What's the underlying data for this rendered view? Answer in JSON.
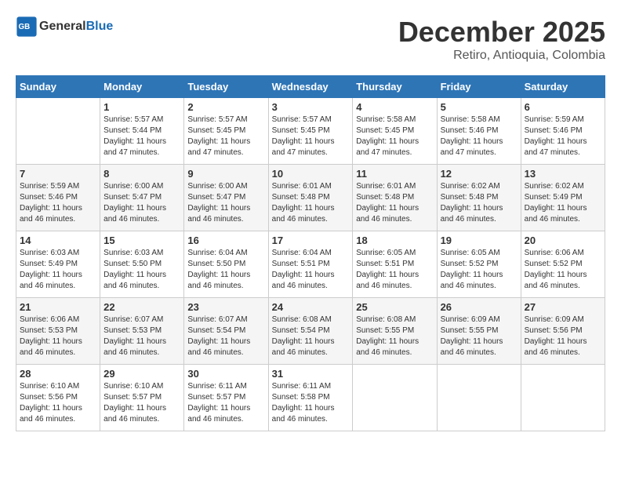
{
  "header": {
    "logo_line1": "General",
    "logo_line2": "Blue",
    "month": "December 2025",
    "location": "Retiro, Antioquia, Colombia"
  },
  "weekdays": [
    "Sunday",
    "Monday",
    "Tuesday",
    "Wednesday",
    "Thursday",
    "Friday",
    "Saturday"
  ],
  "weeks": [
    [
      {
        "day": "",
        "info": ""
      },
      {
        "day": "1",
        "info": "Sunrise: 5:57 AM\nSunset: 5:44 PM\nDaylight: 11 hours\nand 47 minutes."
      },
      {
        "day": "2",
        "info": "Sunrise: 5:57 AM\nSunset: 5:45 PM\nDaylight: 11 hours\nand 47 minutes."
      },
      {
        "day": "3",
        "info": "Sunrise: 5:57 AM\nSunset: 5:45 PM\nDaylight: 11 hours\nand 47 minutes."
      },
      {
        "day": "4",
        "info": "Sunrise: 5:58 AM\nSunset: 5:45 PM\nDaylight: 11 hours\nand 47 minutes."
      },
      {
        "day": "5",
        "info": "Sunrise: 5:58 AM\nSunset: 5:46 PM\nDaylight: 11 hours\nand 47 minutes."
      },
      {
        "day": "6",
        "info": "Sunrise: 5:59 AM\nSunset: 5:46 PM\nDaylight: 11 hours\nand 47 minutes."
      }
    ],
    [
      {
        "day": "7",
        "info": "Sunrise: 5:59 AM\nSunset: 5:46 PM\nDaylight: 11 hours\nand 46 minutes."
      },
      {
        "day": "8",
        "info": "Sunrise: 6:00 AM\nSunset: 5:47 PM\nDaylight: 11 hours\nand 46 minutes."
      },
      {
        "day": "9",
        "info": "Sunrise: 6:00 AM\nSunset: 5:47 PM\nDaylight: 11 hours\nand 46 minutes."
      },
      {
        "day": "10",
        "info": "Sunrise: 6:01 AM\nSunset: 5:48 PM\nDaylight: 11 hours\nand 46 minutes."
      },
      {
        "day": "11",
        "info": "Sunrise: 6:01 AM\nSunset: 5:48 PM\nDaylight: 11 hours\nand 46 minutes."
      },
      {
        "day": "12",
        "info": "Sunrise: 6:02 AM\nSunset: 5:48 PM\nDaylight: 11 hours\nand 46 minutes."
      },
      {
        "day": "13",
        "info": "Sunrise: 6:02 AM\nSunset: 5:49 PM\nDaylight: 11 hours\nand 46 minutes."
      }
    ],
    [
      {
        "day": "14",
        "info": "Sunrise: 6:03 AM\nSunset: 5:49 PM\nDaylight: 11 hours\nand 46 minutes."
      },
      {
        "day": "15",
        "info": "Sunrise: 6:03 AM\nSunset: 5:50 PM\nDaylight: 11 hours\nand 46 minutes."
      },
      {
        "day": "16",
        "info": "Sunrise: 6:04 AM\nSunset: 5:50 PM\nDaylight: 11 hours\nand 46 minutes."
      },
      {
        "day": "17",
        "info": "Sunrise: 6:04 AM\nSunset: 5:51 PM\nDaylight: 11 hours\nand 46 minutes."
      },
      {
        "day": "18",
        "info": "Sunrise: 6:05 AM\nSunset: 5:51 PM\nDaylight: 11 hours\nand 46 minutes."
      },
      {
        "day": "19",
        "info": "Sunrise: 6:05 AM\nSunset: 5:52 PM\nDaylight: 11 hours\nand 46 minutes."
      },
      {
        "day": "20",
        "info": "Sunrise: 6:06 AM\nSunset: 5:52 PM\nDaylight: 11 hours\nand 46 minutes."
      }
    ],
    [
      {
        "day": "21",
        "info": "Sunrise: 6:06 AM\nSunset: 5:53 PM\nDaylight: 11 hours\nand 46 minutes."
      },
      {
        "day": "22",
        "info": "Sunrise: 6:07 AM\nSunset: 5:53 PM\nDaylight: 11 hours\nand 46 minutes."
      },
      {
        "day": "23",
        "info": "Sunrise: 6:07 AM\nSunset: 5:54 PM\nDaylight: 11 hours\nand 46 minutes."
      },
      {
        "day": "24",
        "info": "Sunrise: 6:08 AM\nSunset: 5:54 PM\nDaylight: 11 hours\nand 46 minutes."
      },
      {
        "day": "25",
        "info": "Sunrise: 6:08 AM\nSunset: 5:55 PM\nDaylight: 11 hours\nand 46 minutes."
      },
      {
        "day": "26",
        "info": "Sunrise: 6:09 AM\nSunset: 5:55 PM\nDaylight: 11 hours\nand 46 minutes."
      },
      {
        "day": "27",
        "info": "Sunrise: 6:09 AM\nSunset: 5:56 PM\nDaylight: 11 hours\nand 46 minutes."
      }
    ],
    [
      {
        "day": "28",
        "info": "Sunrise: 6:10 AM\nSunset: 5:56 PM\nDaylight: 11 hours\nand 46 minutes."
      },
      {
        "day": "29",
        "info": "Sunrise: 6:10 AM\nSunset: 5:57 PM\nDaylight: 11 hours\nand 46 minutes."
      },
      {
        "day": "30",
        "info": "Sunrise: 6:11 AM\nSunset: 5:57 PM\nDaylight: 11 hours\nand 46 minutes."
      },
      {
        "day": "31",
        "info": "Sunrise: 6:11 AM\nSunset: 5:58 PM\nDaylight: 11 hours\nand 46 minutes."
      },
      {
        "day": "",
        "info": ""
      },
      {
        "day": "",
        "info": ""
      },
      {
        "day": "",
        "info": ""
      }
    ]
  ]
}
